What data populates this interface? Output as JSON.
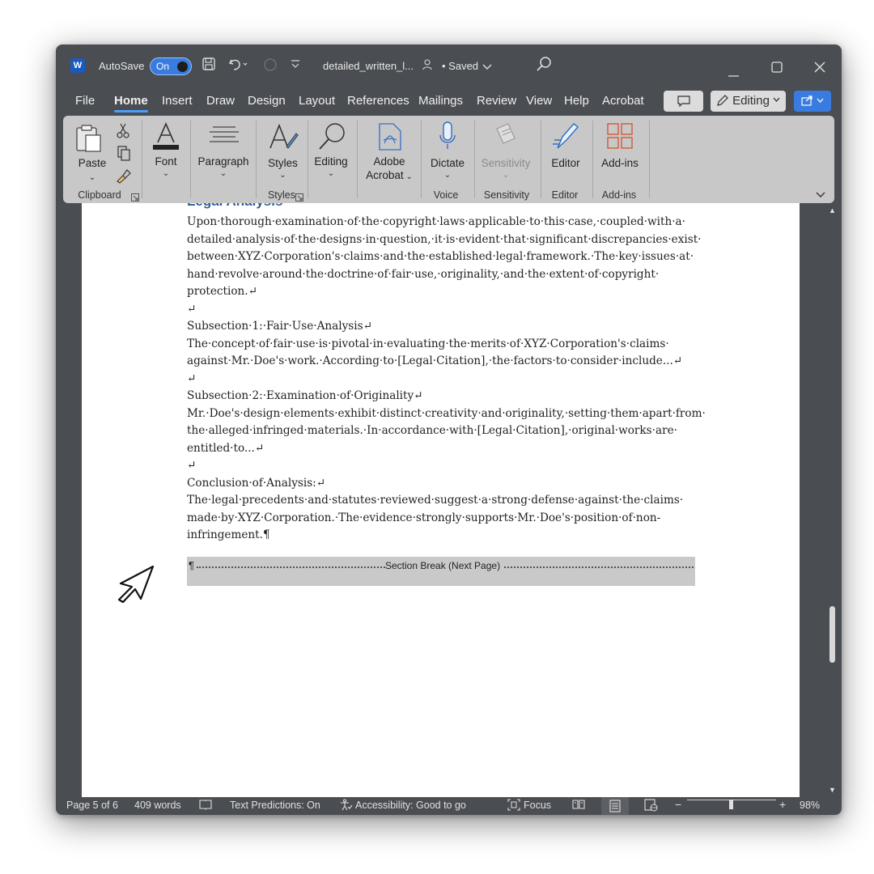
{
  "titlebar": {
    "app_logo": "W",
    "autosave_label": "AutoSave",
    "autosave_state": "On",
    "document_name": "detailed_written_l...",
    "saved_status": "• Saved",
    "icons": [
      "save-icon",
      "undo-icon",
      "redo-icon",
      "customize-icon",
      "search-icon",
      "minimize-icon",
      "maximize-icon",
      "close-icon"
    ]
  },
  "menu": {
    "tabs": [
      "File",
      "Home",
      "Insert",
      "Draw",
      "Design",
      "Layout",
      "References",
      "Mailings",
      "Review",
      "View",
      "Help",
      "Acrobat"
    ],
    "active_tab": "Home",
    "editing_label": "Editing"
  },
  "ribbon": {
    "paste": "Paste",
    "font": "Font",
    "paragraph": "Paragraph",
    "styles": "Styles",
    "editing": "Editing",
    "adobe_line1": "Adobe",
    "adobe_line2": "Acrobat",
    "dictate": "Dictate",
    "sensitivity": "Sensitivity",
    "editor": "Editor",
    "addins": "Add-ins",
    "groups": {
      "clipboard": "Clipboard",
      "styles": "Styles",
      "voice": "Voice",
      "sensitivity": "Sensitivity",
      "editor": "Editor",
      "addins": "Add-ins"
    }
  },
  "document": {
    "heading": "Legal Analysis",
    "lines": [
      "Upon·thorough·examination·of·the·copyright·laws·applicable·to·this·case,·coupled·with·a·",
      "detailed·analysis·of·the·designs·in·question,·it·is·evident·that·significant·discrepancies·exist·",
      "between·XYZ·Corporation's·claims·and·the·established·legal·framework.·The·key·issues·at·",
      "hand·revolve·around·the·doctrine·of·fair·use,·originality,·and·the·extent·of·copyright·",
      "protection.↵",
      "↵",
      "Subsection·1:·Fair·Use·Analysis↵",
      "The·concept·of·fair·use·is·pivotal·in·evaluating·the·merits·of·XYZ·Corporation's·claims·",
      "against·Mr.·Doe's·work.·According·to·[Legal·Citation],·the·factors·to·consider·include...↵",
      "↵",
      "Subsection·2:·Examination·of·Originality↵",
      "Mr.·Doe's·design·elements·exhibit·distinct·creativity·and·originality,·setting·them·apart·from·",
      "the·alleged·infringed·materials.·In·accordance·with·[Legal·Citation],·original·works·are·",
      "entitled·to...↵",
      "↵",
      "Conclusion·of·Analysis:↵",
      "The·legal·precedents·and·statutes·reviewed·suggest·a·strong·defense·against·the·claims·",
      "made·by·XYZ·Corporation.·The·evidence·strongly·supports·Mr.·Doe's·position·of·non-",
      "infringement.¶"
    ],
    "section_break_mark": "¶",
    "section_break": "Section Break (Next Page)"
  },
  "statusbar": {
    "page": "Page 5 of 6",
    "words": "409 words",
    "text_predictions": "Text Predictions: On",
    "accessibility": "Accessibility: Good to go",
    "focus": "Focus",
    "zoom_minus": "−",
    "zoom_plus": "+",
    "zoom": "98%",
    "zoom_level": 0.49
  }
}
